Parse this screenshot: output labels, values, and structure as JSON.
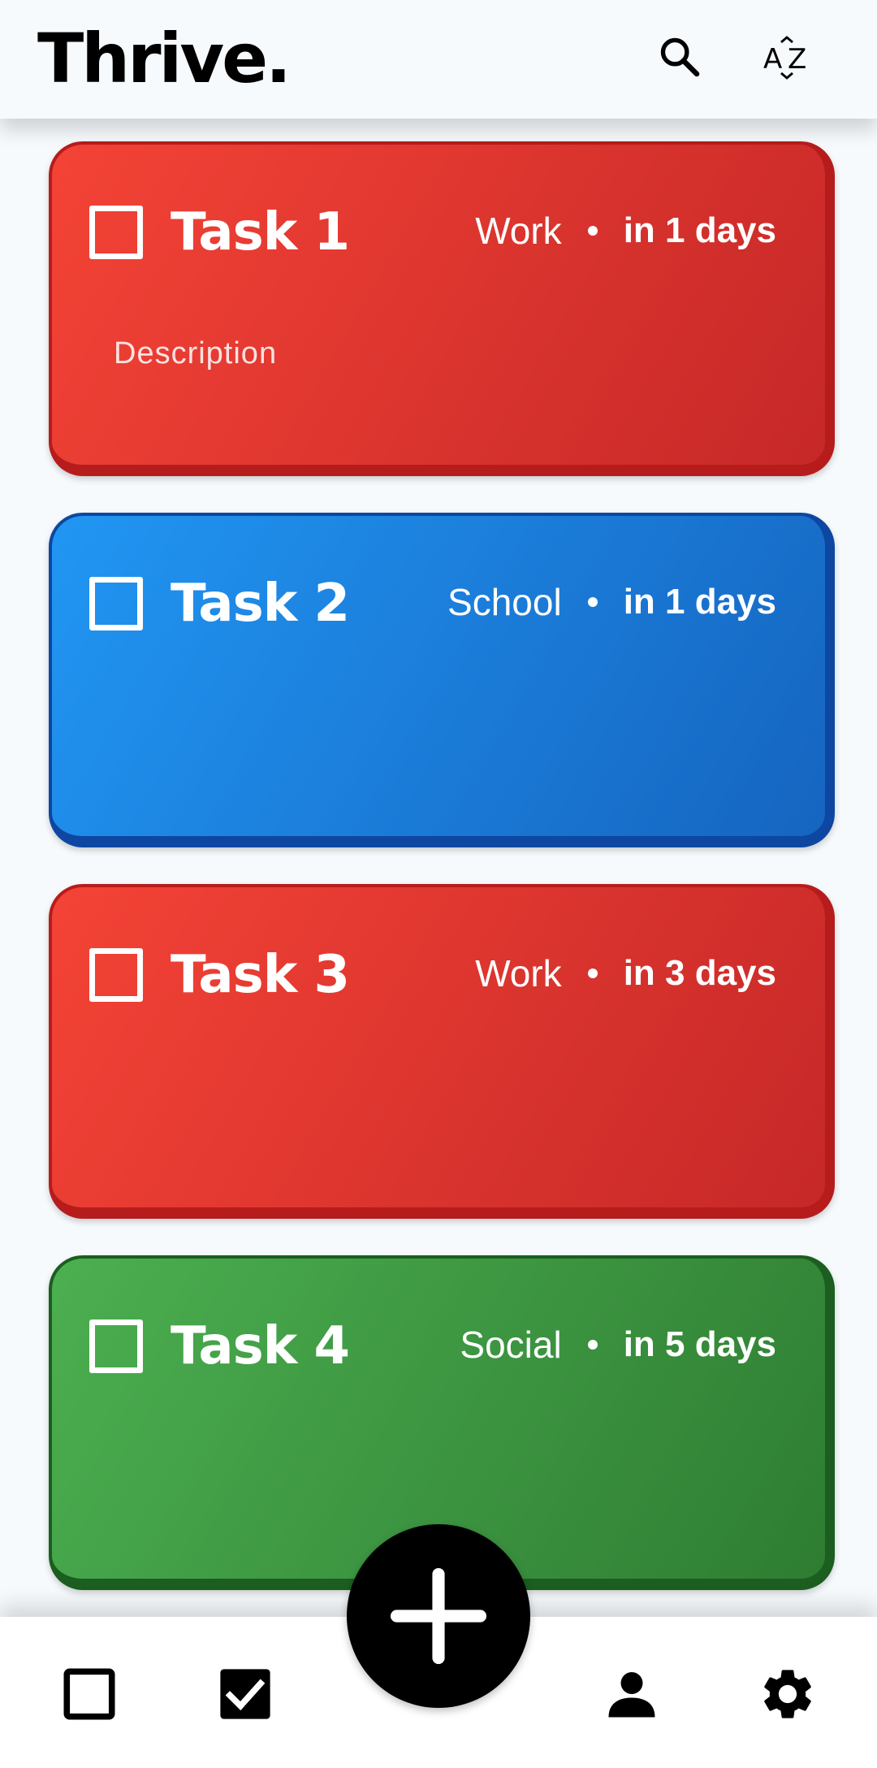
{
  "app": {
    "title": "Thrive."
  },
  "header": {
    "search_icon": "search-icon",
    "sort_icon": "sort-az-icon"
  },
  "tasks": [
    {
      "title": "Task 1",
      "category": "Work",
      "due": "in 1 days",
      "description": "Description",
      "color": "#e53935"
    },
    {
      "title": "Task 2",
      "category": "School",
      "due": "in 1 days",
      "description": "",
      "color": "#1e88e5"
    },
    {
      "title": "Task 3",
      "category": "Work",
      "due": "in 3 days",
      "description": "",
      "color": "#e53935"
    },
    {
      "title": "Task 4",
      "category": "Social",
      "due": "in 5 days",
      "description": "",
      "color": "#43a047"
    }
  ],
  "bottom_nav": {
    "items": [
      {
        "icon": "checkbox-outline-icon"
      },
      {
        "icon": "checkbox-checked-icon"
      },
      {
        "icon": "add-icon"
      },
      {
        "icon": "person-icon"
      },
      {
        "icon": "gear-icon"
      }
    ]
  },
  "colors": {
    "work": "#e53935",
    "school": "#1e88e5",
    "social": "#43a047",
    "background": "#f6fafc",
    "fab": "#000000"
  }
}
